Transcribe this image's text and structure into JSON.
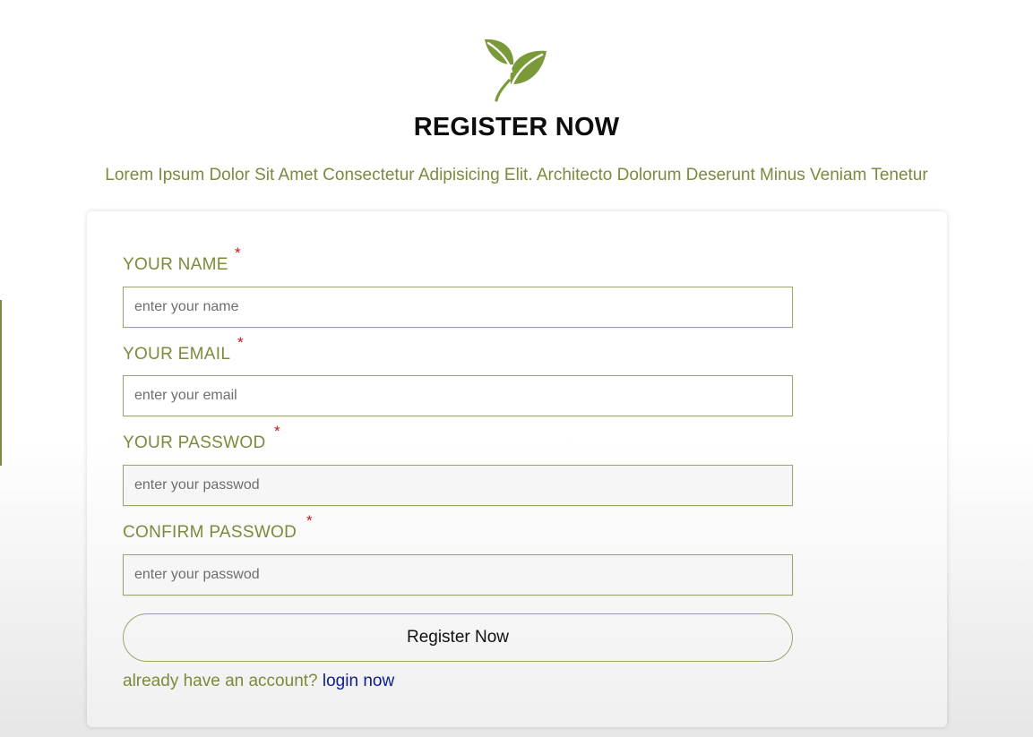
{
  "header": {
    "logo_icon": "leaf-icon",
    "title": "REGISTER NOW",
    "subtitle": "Lorem Ipsum Dolor Sit Amet Consectetur Adipisicing Elit. Architecto Dolorum Deserunt Minus Veniam Tenetur"
  },
  "form": {
    "required_marker": "*",
    "fields": [
      {
        "label": "YOUR NAME",
        "placeholder": "enter your name",
        "value": ""
      },
      {
        "label": "YOUR EMAIL",
        "placeholder": "enter your email",
        "value": ""
      },
      {
        "label": "YOUR PASSWOD",
        "placeholder": "enter your passwod",
        "value": ""
      },
      {
        "label": "CONFIRM PASSWOD",
        "placeholder": "enter your passwod",
        "value": ""
      }
    ],
    "submit_label": "Register Now",
    "login_prompt": "already have an account?",
    "login_link": "login now"
  },
  "colors": {
    "accent": "#7d8a3c",
    "leaf": "#7a9a3a",
    "required": "#cc1111",
    "link": "#0b1e8c"
  }
}
